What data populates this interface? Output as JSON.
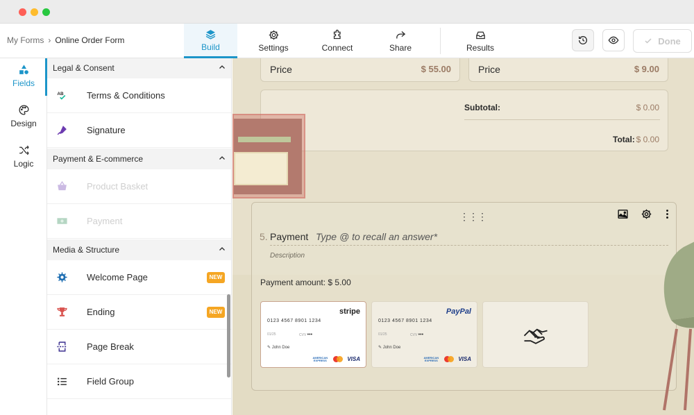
{
  "breadcrumb": {
    "root": "My Forms",
    "current": "Online Order Form"
  },
  "tabs": [
    {
      "label": "Build",
      "icon": "layers-icon",
      "active": true
    },
    {
      "label": "Settings",
      "icon": "gear-icon",
      "active": false
    },
    {
      "label": "Connect",
      "icon": "puzzle-icon",
      "active": false
    },
    {
      "label": "Share",
      "icon": "share-icon",
      "active": false
    },
    {
      "label": "Results",
      "icon": "inbox-icon",
      "active": false
    }
  ],
  "header_actions": {
    "done_label": "Done"
  },
  "rail": [
    {
      "label": "Fields",
      "icon": "shapes-icon",
      "active": true
    },
    {
      "label": "Design",
      "icon": "palette-icon",
      "active": false
    },
    {
      "label": "Logic",
      "icon": "shuffle-icon",
      "active": false
    }
  ],
  "sections": {
    "legal": {
      "title": "Legal & Consent",
      "items": [
        {
          "label": "Terms & Conditions",
          "icon": "terms-icon"
        },
        {
          "label": "Signature",
          "icon": "pen-icon"
        }
      ]
    },
    "payment": {
      "title": "Payment & E-commerce",
      "items": [
        {
          "label": "Product Basket",
          "icon": "basket-icon"
        },
        {
          "label": "Payment",
          "icon": "banknote-icon"
        }
      ]
    },
    "media": {
      "title": "Media & Structure",
      "items": [
        {
          "label": "Welcome Page",
          "icon": "welcome-icon",
          "badge": "NEW"
        },
        {
          "label": "Ending",
          "icon": "trophy-icon",
          "badge": "NEW"
        },
        {
          "label": "Page Break",
          "icon": "page-break-icon"
        },
        {
          "label": "Field Group",
          "icon": "list-icon"
        }
      ]
    }
  },
  "canvas": {
    "price_cards": [
      {
        "label": "Price",
        "value": "$ 55.00"
      },
      {
        "label": "Price",
        "value": "$ 9.00"
      }
    ],
    "summary": {
      "subtotal_label": "Subtotal:",
      "subtotal_value": "$ 0.00",
      "total_label": "Total:",
      "total_value": "$ 0.00"
    },
    "question": {
      "number": "5.",
      "title": "Payment",
      "placeholder": "Type @ to recall an answer",
      "required_mark": "*",
      "description": "Description",
      "amount_text": "Payment amount: $ 5.00"
    },
    "payment_cards": [
      {
        "brand": "stripe",
        "number": "0123 4567 8901 1234",
        "exp": "01/25",
        "cvv_label": "CVV",
        "cvv": "•••",
        "holder": "John Doe",
        "amex": "AMERICAN EXPRESS",
        "visa": "VISA"
      },
      {
        "brand": "PayPal",
        "number": "0123 4567 8901 1234",
        "exp": "01/25",
        "cvv_label": "CVV",
        "cvv": "•••",
        "holder": "John Doe",
        "amex": "AMERICAN EXPRESS",
        "visa": "VISA"
      }
    ]
  },
  "colors": {
    "accent": "#1c95c9",
    "badge": "#f5a623",
    "canvas": "#e7e0cb",
    "price": "#9b7b65"
  }
}
